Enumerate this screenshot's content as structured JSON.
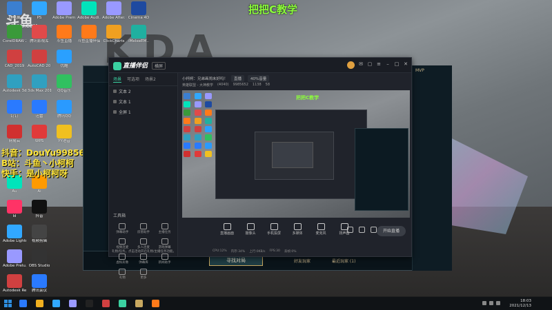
{
  "banner": "把把C教学",
  "watermark": {
    "main": "斗鱼",
    "sub": "DOUYU.COM"
  },
  "overlay": {
    "line1": "抖音：DouYu9985652",
    "line2": "B站：斗鱼丶小柯柯",
    "line3": "快手：是小柯柯呀"
  },
  "desktop_icons": [
    {
      "label": "此电脑",
      "color": "#3b7fd0"
    },
    {
      "label": "PS",
      "color": "#31a8ff"
    },
    {
      "label": "Adobe Prem..",
      "color": "#9999ff"
    },
    {
      "label": "Adobe Audi..",
      "color": "#00e4bb"
    },
    {
      "label": "Adobe After..",
      "color": "#9999ff"
    },
    {
      "label": "Cinema 4D",
      "color": "#1e4aa0"
    },
    {
      "label": "CorelDRAW 2020 (64..",
      "color": "#3a9a3a"
    },
    {
      "label": "腾讯影视库",
      "color": "#e04a4a"
    },
    {
      "label": "斗鱼直播",
      "color": "#ff7a1a"
    },
    {
      "label": "斗鱼直播伴侣",
      "color": "#ff7a1a"
    },
    {
      "label": "ClickCharts",
      "color": "#f0a020"
    },
    {
      "label": "iMeleeEM..",
      "color": "#20b0a0"
    },
    {
      "label": "CAD_2019",
      "color": "#d04040"
    },
    {
      "label": "AutoCAD 2019 - 简..",
      "color": "#d04040"
    },
    {
      "label": "优酷",
      "color": "#2aa0ff"
    },
    {
      "label": "Autodesk 3ds Max",
      "color": "#30a0c0"
    },
    {
      "label": "3ds Max 2019",
      "color": "#30a0c0"
    },
    {
      "label": "QQ音乐",
      "color": "#30c060"
    },
    {
      "label": "钉钉",
      "color": "#2a7aff"
    },
    {
      "label": "迅雷",
      "color": "#2a7aff"
    },
    {
      "label": "腾讯QQ",
      "color": "#2a9aff"
    },
    {
      "label": "网易云",
      "color": "#d03030"
    },
    {
      "label": "WPS",
      "color": "#e03a3a"
    },
    {
      "label": "YY语音",
      "color": "#f0c020"
    },
    {
      "label": "Au",
      "color": "#00e4bb"
    },
    {
      "label": "Ai",
      "color": "#ff9a00"
    },
    {
      "label": "Id",
      "color": "#ff3366"
    },
    {
      "label": "抖音",
      "color": "#111111"
    },
    {
      "label": "Adobe Lightroom",
      "color": "#31a8ff"
    },
    {
      "label": "视频剪辑",
      "color": "#444444"
    },
    {
      "label": "Adobe Prelu..",
      "color": "#9999ff"
    },
    {
      "label": "OBS Studio",
      "color": "#333333"
    },
    {
      "label": "Autodesk ReCap",
      "color": "#d04040"
    },
    {
      "label": "腾讯会议",
      "color": "#2a7aff"
    }
  ],
  "app": {
    "logo": "直播伴侣",
    "version": "横屏",
    "scene_tabs": [
      "场景",
      "可选项",
      "场景2"
    ],
    "sources": [
      "文本 2",
      "文本 1",
      "全屏 1"
    ],
    "room_label": "小柯柯：兄弟画闹未好吗！",
    "pill1": "直播",
    "pill2": "40%音量",
    "category": "英雄联盟 - 大神教学",
    "viewers": "(4040)",
    "stat_a": "9985652",
    "stat_b": "1138",
    "stat_c": "58",
    "tools_title": "工具箱",
    "tools": [
      "弹幕助手",
      "房管助手",
      "主播任务",
      "视频连麦",
      "多人连麦",
      "游戏弹幕",
      "虚拟形象",
      "弹幕库",
      "新闻助手",
      "礼物",
      "更多"
    ],
    "notice": "礼物/任务，点击活动开启礼物/主播任务功能。",
    "bottom_tools": [
      "直播画面",
      "摄像头",
      "手机投屏",
      "多媒体",
      "麦克风",
      "扬声器"
    ],
    "start_live": "开始直播",
    "status": [
      "CPU:12%",
      "内存:34%",
      "上行:0KB/s",
      "FPS:30",
      "丢帧:0%"
    ]
  },
  "lol": {
    "find_button": "寻找对局",
    "tab_friends": "好友玩家",
    "tab_recent": "最近玩家 (1)",
    "chat_header": "MVP"
  },
  "taskbar": {
    "time": "18:03",
    "date": "2021/12/13"
  }
}
